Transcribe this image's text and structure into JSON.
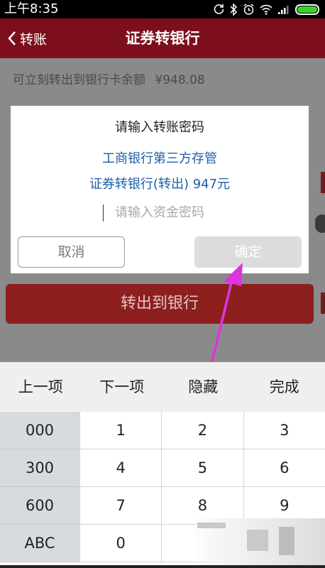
{
  "status_bar": {
    "time": "上午8:35",
    "icons": [
      "alarm-sync-icon",
      "bluetooth-icon",
      "alarm-clock-icon",
      "wifi-icon",
      "signal-icon",
      "battery-icon"
    ],
    "battery_color": "#3cd12f"
  },
  "nav": {
    "back_label": "转账",
    "title": "证券转银行",
    "color": "#7d0f1c"
  },
  "balance": {
    "label": "可立刻转出到银行卡余额",
    "value": "¥948.08"
  },
  "transfer_button": {
    "label": "转出到银行"
  },
  "dialog": {
    "title": "请输入转账密码",
    "line1": "工商银行第三方存管",
    "line2": "证券转银行(转出) 947元",
    "password_placeholder": "请输入资金密码",
    "password_value": "",
    "cancel_label": "取消",
    "confirm_label": "确定"
  },
  "annotation": {
    "arrow_color": "#e032e0"
  },
  "keyboard": {
    "actions": [
      "上一项",
      "下一项",
      "隐藏",
      "完成"
    ],
    "rows": [
      {
        "prefix": "000",
        "keys": [
          "1",
          "2",
          "3"
        ]
      },
      {
        "prefix": "300",
        "keys": [
          "4",
          "5",
          "6"
        ]
      },
      {
        "prefix": "600",
        "keys": [
          "7",
          "8",
          "9"
        ]
      },
      {
        "prefix": "ABC",
        "keys": [
          "0",
          "",
          ""
        ]
      }
    ]
  }
}
